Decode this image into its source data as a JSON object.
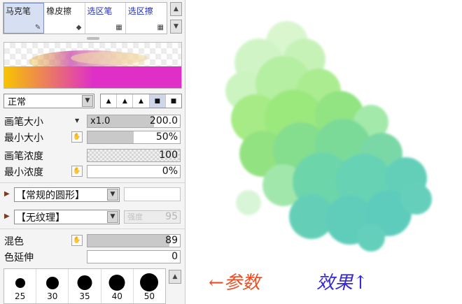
{
  "tools": [
    {
      "label": "马克笔",
      "icon": "pen-icon",
      "glyph": "✎",
      "active": true
    },
    {
      "label": "橡皮擦",
      "icon": "eraser-icon",
      "glyph": "◆",
      "active": false
    },
    {
      "label": "选区笔",
      "icon": "select-pen-icon",
      "glyph": "▦",
      "active": false
    },
    {
      "label": "选区擦",
      "icon": "select-eraser-icon",
      "glyph": "▦",
      "active": false
    }
  ],
  "preview": {
    "colors": [
      "#f7c400",
      "#df2fc7",
      "#ffe070"
    ]
  },
  "blend_mode": {
    "value": "正常"
  },
  "brush_shapes": [
    "▲",
    "▲",
    "▲",
    "■",
    "■"
  ],
  "params": {
    "brush_size": {
      "label": "画笔大小",
      "multiplier": "x1.0",
      "value": "200.0",
      "fill": 0.72
    },
    "min_size": {
      "label": "最小大小",
      "value": "50%",
      "fill": 0.5
    },
    "density": {
      "label": "画笔浓度",
      "value": "100",
      "fill": 1.0
    },
    "min_density": {
      "label": "最小浓度",
      "value": "0%",
      "fill": 0.0
    },
    "blend": {
      "label": "混色",
      "value": "89",
      "fill": 0.89
    },
    "persistence": {
      "label": "色延伸",
      "value": "0",
      "fill": 0.0
    }
  },
  "shape_select": {
    "value": "【常规的圆形】"
  },
  "texture_select": {
    "value": "【无纹理】",
    "strength_label": "强度",
    "strength_value": "95"
  },
  "brush_sizes": [
    25,
    30,
    35,
    40,
    50
  ],
  "annotations": {
    "params": "←参数",
    "effect": "效果↑"
  },
  "colors": {
    "accent": "#2330b7",
    "annotation_red": "#ef4b1f",
    "annotation_blue": "#3428d9"
  }
}
